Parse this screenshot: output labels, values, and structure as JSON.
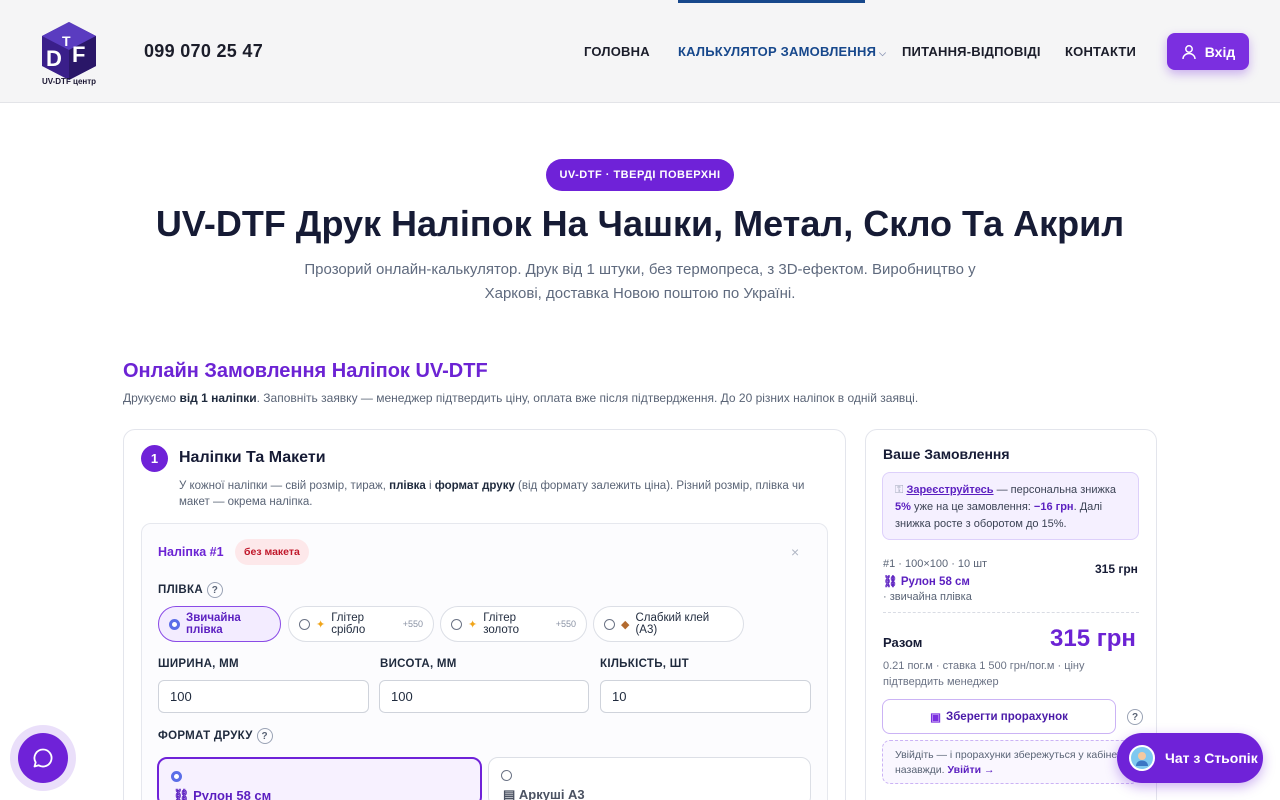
{
  "header": {
    "logo_text": "UV-DTF центр",
    "phone": "099 070 25 47",
    "nav": [
      {
        "label": "ГОЛОВНА"
      },
      {
        "label": "КАЛЬКУЛЯТОР ЗАМОВЛЕННЯ"
      },
      {
        "label": "ПИТАННЯ-ВІДПОВІДІ"
      },
      {
        "label": "КОНТАКТИ"
      }
    ],
    "login_label": "Вхід"
  },
  "hero": {
    "pill": "UV-DTF · ТВЕРДІ ПОВЕРХНІ",
    "title": "UV-DTF Друк Наліпок На Чашки, Метал, Скло Та Акрил",
    "subtitle": "Прозорий онлайн-калькулятор. Друк від 1 штуки, без термопреса, з 3D-ефектом. Виробництво у Харкові, доставка Новою поштою по Україні."
  },
  "section": {
    "title": "Онлайн Замовлення Наліпок UV-DTF",
    "sub_pre": "Друкуємо ",
    "sub_bold": "від 1 наліпки",
    "sub_post": ". Заповніть заявку — менеджер підтвердить ціну, оплата вже після підтвердження. До 20 різних наліпок в одній заявці."
  },
  "step": {
    "number": "1",
    "title": "Наліпки Та Макети",
    "desc_1": "У кожної наліпки — свій розмір, тираж, ",
    "desc_b1": "плівка",
    "desc_2": " і ",
    "desc_b2": "формат друку",
    "desc_3": " (від формату залежить ціна). Різний розмір, плівка чи макет — окрема наліпка."
  },
  "sticker": {
    "label": "Наліпка #1",
    "badge": "без макета",
    "close": "×",
    "film_label": "ПЛІВКА",
    "help": "?",
    "films": [
      {
        "label": "Звичайна плівка",
        "extra": ""
      },
      {
        "label": "Глітер срібло",
        "extra": "+550"
      },
      {
        "label": "Глітер золото",
        "extra": "+550"
      },
      {
        "label": "Слабкий клей (А3)",
        "extra": ""
      }
    ],
    "width_label": "ШИРИНА, ММ",
    "height_label": "ВИСОТА, ММ",
    "qty_label": "КІЛЬКІСТЬ, ШТ",
    "width_value": "100",
    "height_value": "100",
    "qty_value": "10",
    "format_label": "ФОРМАТ ДРУКУ",
    "formats": [
      {
        "label": "Рулон 58 см"
      },
      {
        "label": "Аркуші А3"
      }
    ]
  },
  "order": {
    "title": "Ваше Замовлення",
    "promo_link": "Зареєструйтесь",
    "promo_1": " — персональна знижка ",
    "promo_b1": "5%",
    "promo_2": " уже на це замовлення: ",
    "promo_b2": "−16 грн",
    "promo_3": ". Далі знижка росте з оборотом до 15%.",
    "item_line1": "#1 · 100×100 · 10 шт",
    "item_line2": "Рулон 58 см",
    "item_line3": "· звичайна плівка",
    "item_price": "315 грн",
    "total_label": "Разом",
    "total_value": "315 грн",
    "total_note": "0.21 пог.м · ставка 1 500 грн/пог.м · ціну підтвердить менеджер",
    "save_label": "Зберегти прорахунок",
    "hint_1": "Увійдіть — і прорахунки збережуться у кабінеті",
    "hint_2": "назавжди. ",
    "hint_link": "Увійти →"
  },
  "chat": {
    "label": "Чат з Стьопік"
  },
  "colors": {
    "accent": "#6f22d8",
    "nav_active": "#17488c"
  }
}
